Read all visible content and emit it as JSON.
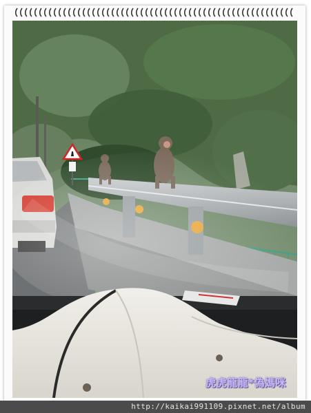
{
  "photo": {
    "subject": "macaque monkeys sitting on a roadside guardrail seen through a car windshield",
    "signature": "虎虎龍龍*偽媽咪"
  },
  "footer": {
    "url": "http://kaikai991109.pixnet.net/album"
  },
  "colors": {
    "frame": "#fbfbfb",
    "footer_bar": "#4b4b4b",
    "signature": "#c9b8f4"
  },
  "icons": [
    "spiral-binding-icon",
    "warning-sign-icon"
  ]
}
